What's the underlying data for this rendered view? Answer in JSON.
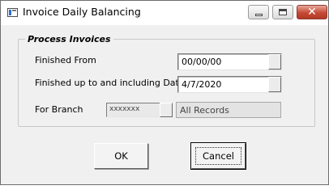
{
  "window": {
    "title": "Invoice Daily Balancing",
    "controls": {
      "minimize": "minimize",
      "maximize": "maximize",
      "close": "close"
    }
  },
  "group": {
    "title": "Process Invoices"
  },
  "fields": {
    "finished_from": {
      "label": "Finished From",
      "value": "00/00/00"
    },
    "finished_to": {
      "label": "Finished up to and including Date",
      "value": "4/7/2020"
    },
    "branch": {
      "label": "For Branch",
      "code": "xxxxxxx",
      "name": "All Records"
    }
  },
  "buttons": {
    "ok": "OK",
    "cancel": "Cancel"
  },
  "colors": {
    "dialog_bg": "#f0f0f0",
    "close_button": "#c64a36"
  }
}
